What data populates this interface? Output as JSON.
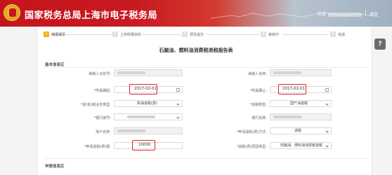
{
  "header": {
    "title": "国家税务总局上海市电子税务局",
    "user_label": "欢迎",
    "logout": "退出"
  },
  "help_label": "?",
  "steps": [
    {
      "num": "1",
      "label": "填报填写",
      "active": true
    },
    {
      "num": "2",
      "label": "上传附报资料",
      "active": false
    },
    {
      "num": "3",
      "label": "预览提交",
      "active": false
    },
    {
      "num": "4",
      "label": "审核中",
      "active": false
    },
    {
      "num": "5",
      "label": "完成",
      "active": false
    }
  ],
  "form_title": "石脑油、燃料油消费税退税报告表",
  "sections": {
    "basic": "基本信息区",
    "apply": "申报信息区"
  },
  "fields": {
    "taxpayer_id": {
      "label": "纳税人识别号:",
      "value": ""
    },
    "taxpayer_name": {
      "label": "纳税人名称:",
      "value": ""
    },
    "period_start": {
      "label": "*所属期起:",
      "value": "2017-02-01"
    },
    "period_end": {
      "label": "*所属期止:",
      "value": "2017-02-01"
    },
    "refund_type": {
      "label": "*退(抵)税业务类型:",
      "value": "购油退税(费)"
    },
    "oil_type": {
      "label": "*退税类型:",
      "value": "国产油退税"
    },
    "bank": {
      "label": "*银行账号:",
      "value": ""
    },
    "bank_name": {
      "label": "银行名称:",
      "value": ""
    },
    "account_name": {
      "label": "账户名称:",
      "value": ""
    },
    "refund_method": {
      "label": "*申请退税(费)方式:",
      "value": "退税"
    },
    "amount": {
      "label": "*申请退税(费)额:",
      "value": "10000"
    },
    "refund_reason": {
      "label": "*退税(费)原因类型:",
      "value": "石脑油、燃料油消费税退税"
    }
  }
}
